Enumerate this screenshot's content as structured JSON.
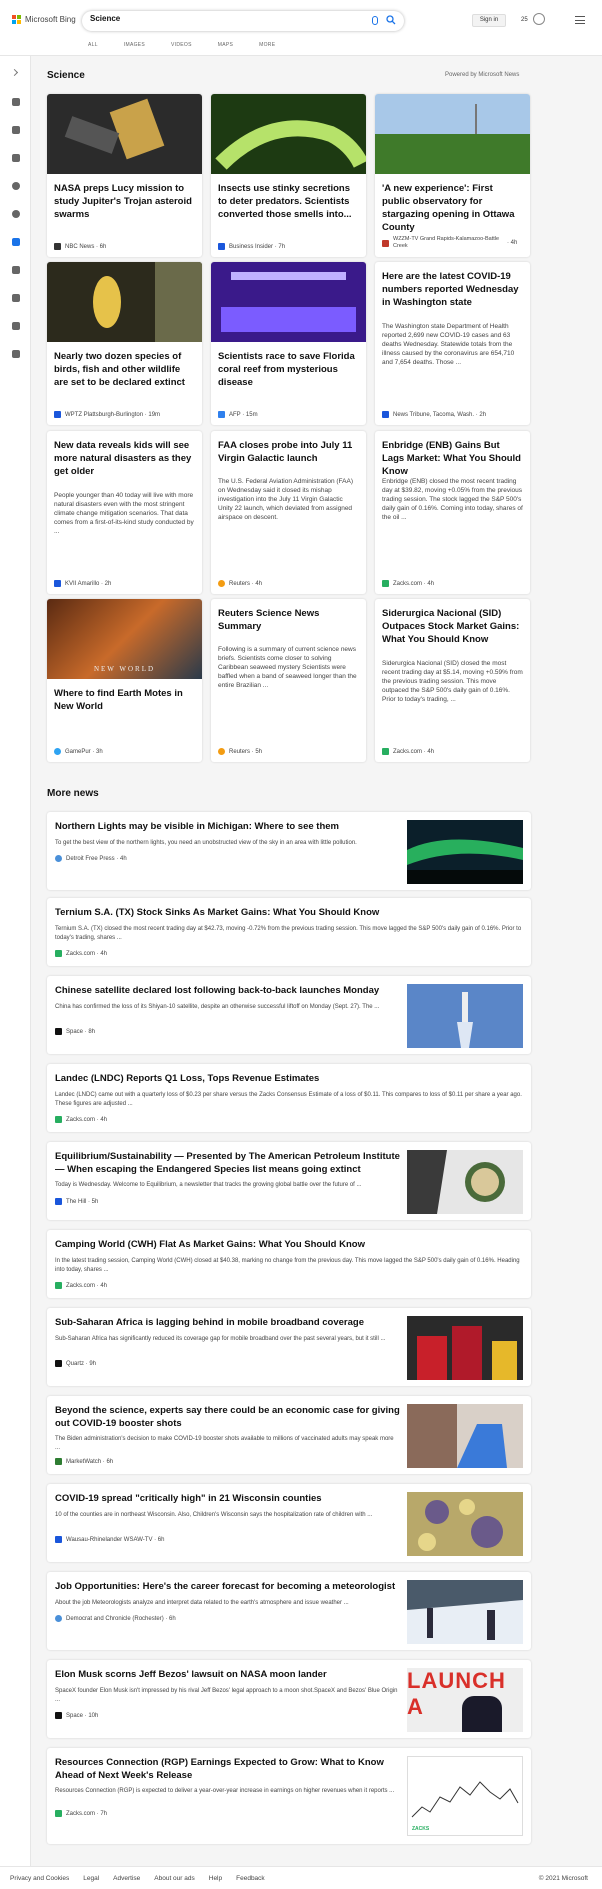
{
  "header": {
    "brand": "Microsoft Bing",
    "search_value": "Science",
    "tabs": [
      "ALL",
      "IMAGES",
      "VIDEOS",
      "MAPS",
      "MORE"
    ],
    "signin_label": "Sign in",
    "points": "25"
  },
  "main": {
    "section_title": "Science",
    "powered_by": "Powered by Microsoft News",
    "cards": [
      {
        "title": "NASA preps Lucy mission to study Jupiter's Trojan asteroid swarms",
        "desc": "",
        "source": "NBC News · 6h",
        "src_color": "#333"
      },
      {
        "title": "Insects use stinky secretions to deter predators. Scientists converted those smells into...",
        "desc": "",
        "source": "Business Insider · 7h",
        "src_color": "#1a56db"
      },
      {
        "title": "'A new experience': First public observatory for stargazing opening in Ottawa County",
        "desc": "",
        "source": "WZZM-TV Grand Rapids-Kalamazoo-Battle Creek",
        "age": "· 4h",
        "src_color": "#c0392b"
      },
      {
        "title": "Nearly two dozen species of birds, fish and other wildlife are set to be declared extinct",
        "desc": "",
        "source": "WPTZ Plattsburgh-Burlington · 19m",
        "src_color": "#1a56db"
      },
      {
        "title": "Scientists race to save Florida coral reef from mysterious disease",
        "desc": "",
        "source": "AFP · 15m",
        "src_color": "#2f80ed"
      },
      {
        "title": "Here are the latest COVID-19 numbers reported Wednesday in Washington state",
        "desc": "The Washington state Department of Health reported 2,699 new COVID-19 cases and 63 deaths Wednesday. Statewide totals from the illness caused by the coronavirus are 654,710 and 7,654 deaths. Those ...",
        "source": "News Tribune, Tacoma, Wash. · 2h",
        "src_color": "#1a56db"
      },
      {
        "title": "New data reveals kids will see more natural disasters as they get older",
        "desc": "People younger than 40 today will live with more natural disasters even with the most stringent climate change mitigation scenarios. That data comes from a first-of-its-kind study conducted by ...",
        "source": "KVII Amarillo · 2h",
        "src_color": "#1a56db"
      },
      {
        "title": "FAA closes probe into July 11 Virgin Galactic launch",
        "desc": "The U.S. Federal Aviation Administration (FAA) on Wednesday said it closed its mishap investigation into the July 11 Virgin Galactic Unity 22 launch, which deviated from assigned airspace on descent.",
        "source": "Reuters · 4h",
        "src_color": "#f39c12"
      },
      {
        "title": "Enbridge (ENB) Gains But Lags Market: What You Should Know",
        "desc": "Enbridge (ENB) closed the most recent trading day at $39.82, moving +0.05% from the previous trading session. The stock lagged the S&P 500's daily gain of 0.16%. Coming into today, shares of the oil ...",
        "source": "Zacks.com · 4h",
        "src_color": "#27ae60"
      },
      {
        "title": "Where to find Earth Motes in New World",
        "desc": "",
        "source": "GamePur · 3h",
        "src_color": "#2ea3f2",
        "img_text": "NEW WORLD"
      },
      {
        "title": "Reuters Science News Summary",
        "desc": "Following is a summary of current science news briefs. Scientists come closer to solving Caribbean seaweed mystery Scientists were baffled when a band of seaweed longer than the entire Brazilian ...",
        "source": "Reuters · 5h",
        "src_color": "#f39c12"
      },
      {
        "title": "Siderurgica Nacional (SID) Outpaces Stock Market Gains: What You Should Know",
        "desc": "Siderurgica Nacional (SID) closed the most recent trading day at $5.14, moving +0.59% from the previous trading session. This move outpaced the S&P 500's daily gain of 0.16%. Prior to today's trading, ...",
        "source": "Zacks.com · 4h",
        "src_color": "#27ae60"
      }
    ],
    "more_title": "More news",
    "more_news": [
      {
        "title": "Northern Lights may be visible in Michigan: Where to see them",
        "desc": "To get the best view of the northern lights, you need an unobstructed view of the sky in an area with little pollution.",
        "source": "Detroit Free Press · 4h",
        "src_color": "#4a90d9"
      },
      {
        "title": "Ternium S.A. (TX) Stock Sinks As Market Gains: What You Should Know",
        "desc": "Ternium S.A. (TX) closed the most recent trading day at $42.73, moving -0.72% from the previous trading session. This move lagged the S&P 500's daily gain of 0.16%. Prior to today's trading, shares ...",
        "source": "Zacks.com · 4h",
        "src_color": "#27ae60"
      },
      {
        "title": "Chinese satellite declared lost following back-to-back launches Monday",
        "desc": "China has confirmed the loss of its Shiyan-10 satellite, despite an otherwise successful liftoff on Monday (Sept. 27). The ...",
        "source": "Space · 8h",
        "src_color": "#111"
      },
      {
        "title": "Landec (LNDC) Reports Q1 Loss, Tops Revenue Estimates",
        "desc": "Landec (LNDC) came out with a quarterly loss of $0.23 per share versus the Zacks Consensus Estimate of a loss of $0.11. This compares to loss of $0.11 per share a year ago. These figures are adjusted ...",
        "source": "Zacks.com · 4h",
        "src_color": "#27ae60"
      },
      {
        "title": "Equilibrium/Sustainability — Presented by The American Petroleum Institute — When escaping the Endangered Species list means going extinct",
        "desc": "Today is Wednesday. Welcome to Equilibrium, a newsletter that tracks the growing global battle over the future of ...",
        "source": "The Hill · 5h",
        "src_color": "#1a56db"
      },
      {
        "title": "Camping World (CWH) Flat As Market Gains: What You Should Know",
        "desc": "In the latest trading session, Camping World (CWH) closed at $40.38, marking no change from the previous day. This move lagged the S&P 500's daily gain of 0.16%. Heading into today, shares ...",
        "source": "Zacks.com · 4h",
        "src_color": "#27ae60"
      },
      {
        "title": "Sub-Saharan Africa is lagging behind in mobile broadband coverage",
        "desc": "Sub-Saharan Africa has significantly reduced its coverage gap for mobile broadband over the past several years, but it still ...",
        "source": "Quartz · 9h",
        "src_color": "#111"
      },
      {
        "title": "Beyond the science, experts say there could be an economic case for giving out COVID-19 booster shots",
        "desc": "The Biden administration's decision to make COVID-19 booster shots available to millions of vaccinated adults may speak more ...",
        "source": "MarketWatch · 6h",
        "src_color": "#2e7d32"
      },
      {
        "title": "COVID-19 spread \"critically high\" in 21 Wisconsin counties",
        "desc": "10 of the counties are in northeast Wisconsin. Also, Children's Wisconsin says the hospitalization rate of children with ...",
        "source": "Wausau-Rhinelander WSAW-TV · 6h",
        "src_color": "#1a56db"
      },
      {
        "title": "Job Opportunities: Here's the career forecast for becoming a meteorologist",
        "desc": "About the job Meteorologists analyze and interpret data related to the earth's atmosphere and issue weather ...",
        "source": "Democrat and Chronicle (Rochester) · 6h",
        "src_color": "#4a90d9"
      },
      {
        "title": "Elon Musk scorns Jeff Bezos' lawsuit on NASA moon lander",
        "desc": "SpaceX founder Elon Musk isn't impressed by his rival Jeff Bezos' legal approach to a moon shot.SpaceX and Bezos' Blue Origin ...",
        "source": "Space · 10h",
        "src_color": "#111",
        "img_text": "LAUNCH A"
      },
      {
        "title": "Resources Connection (RGP) Earnings Expected to Grow: What to Know Ahead of Next Week's Release",
        "desc": "Resources Connection (RGP) is expected to deliver a year-over-year increase in earnings on higher revenues when it reports ...",
        "source": "Zacks.com · 7h",
        "src_color": "#27ae60",
        "img_text": "ZACKS"
      }
    ]
  },
  "footer": {
    "links": [
      "Privacy and Cookies",
      "Legal",
      "Advertise",
      "About our ads",
      "Help",
      "Feedback"
    ],
    "copyright": "© 2021 Microsoft"
  },
  "icons": {
    "logo": "microsoft-logo-icon",
    "mic": "mic-icon",
    "search": "search-icon",
    "rewards": "rewards-icon",
    "menu": "hamburger-menu-icon"
  },
  "colors": {
    "accent": "#1a73e8",
    "ms_red": "#f25022",
    "ms_green": "#7fba00",
    "ms_blue": "#00a4ef",
    "ms_yellow": "#ffb900"
  }
}
